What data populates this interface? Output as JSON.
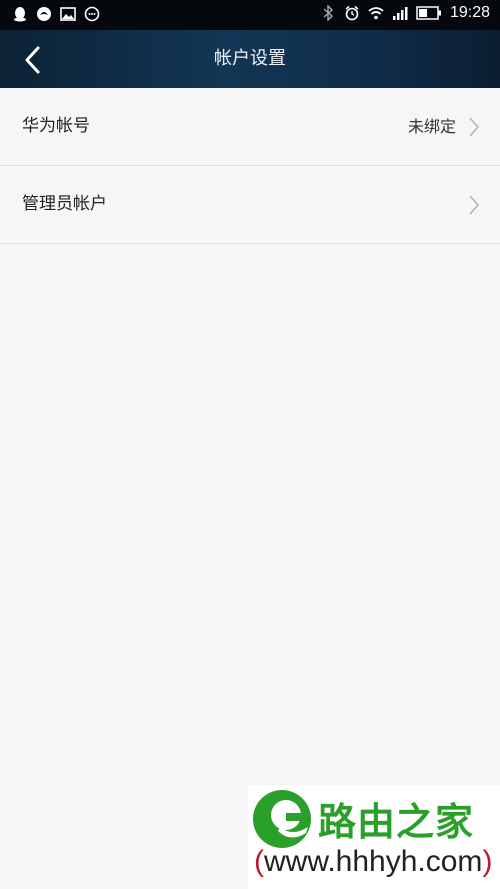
{
  "status_bar": {
    "time": "19:28",
    "left_icons": [
      "qq-icon",
      "baidu-icon",
      "image-icon",
      "chat-icon"
    ],
    "right_icons": [
      "bluetooth-icon",
      "alarm-icon",
      "wifi-icon",
      "signal-icon",
      "battery-icon"
    ]
  },
  "header": {
    "title": "帐户设置",
    "back_icon": "back-arrow-icon"
  },
  "list": {
    "items": [
      {
        "label": "华为帐号",
        "value": "未绑定"
      },
      {
        "label": "管理员帐户",
        "value": ""
      }
    ]
  },
  "watermark": {
    "logo_text": "路由之家",
    "url_prefix": "(",
    "url_text": "www.hhhyh.com",
    "url_suffix": ")"
  },
  "colors": {
    "header_bg": "#123655",
    "page_bg": "#f6f5f8",
    "watermark_green": "#2aa02a"
  }
}
